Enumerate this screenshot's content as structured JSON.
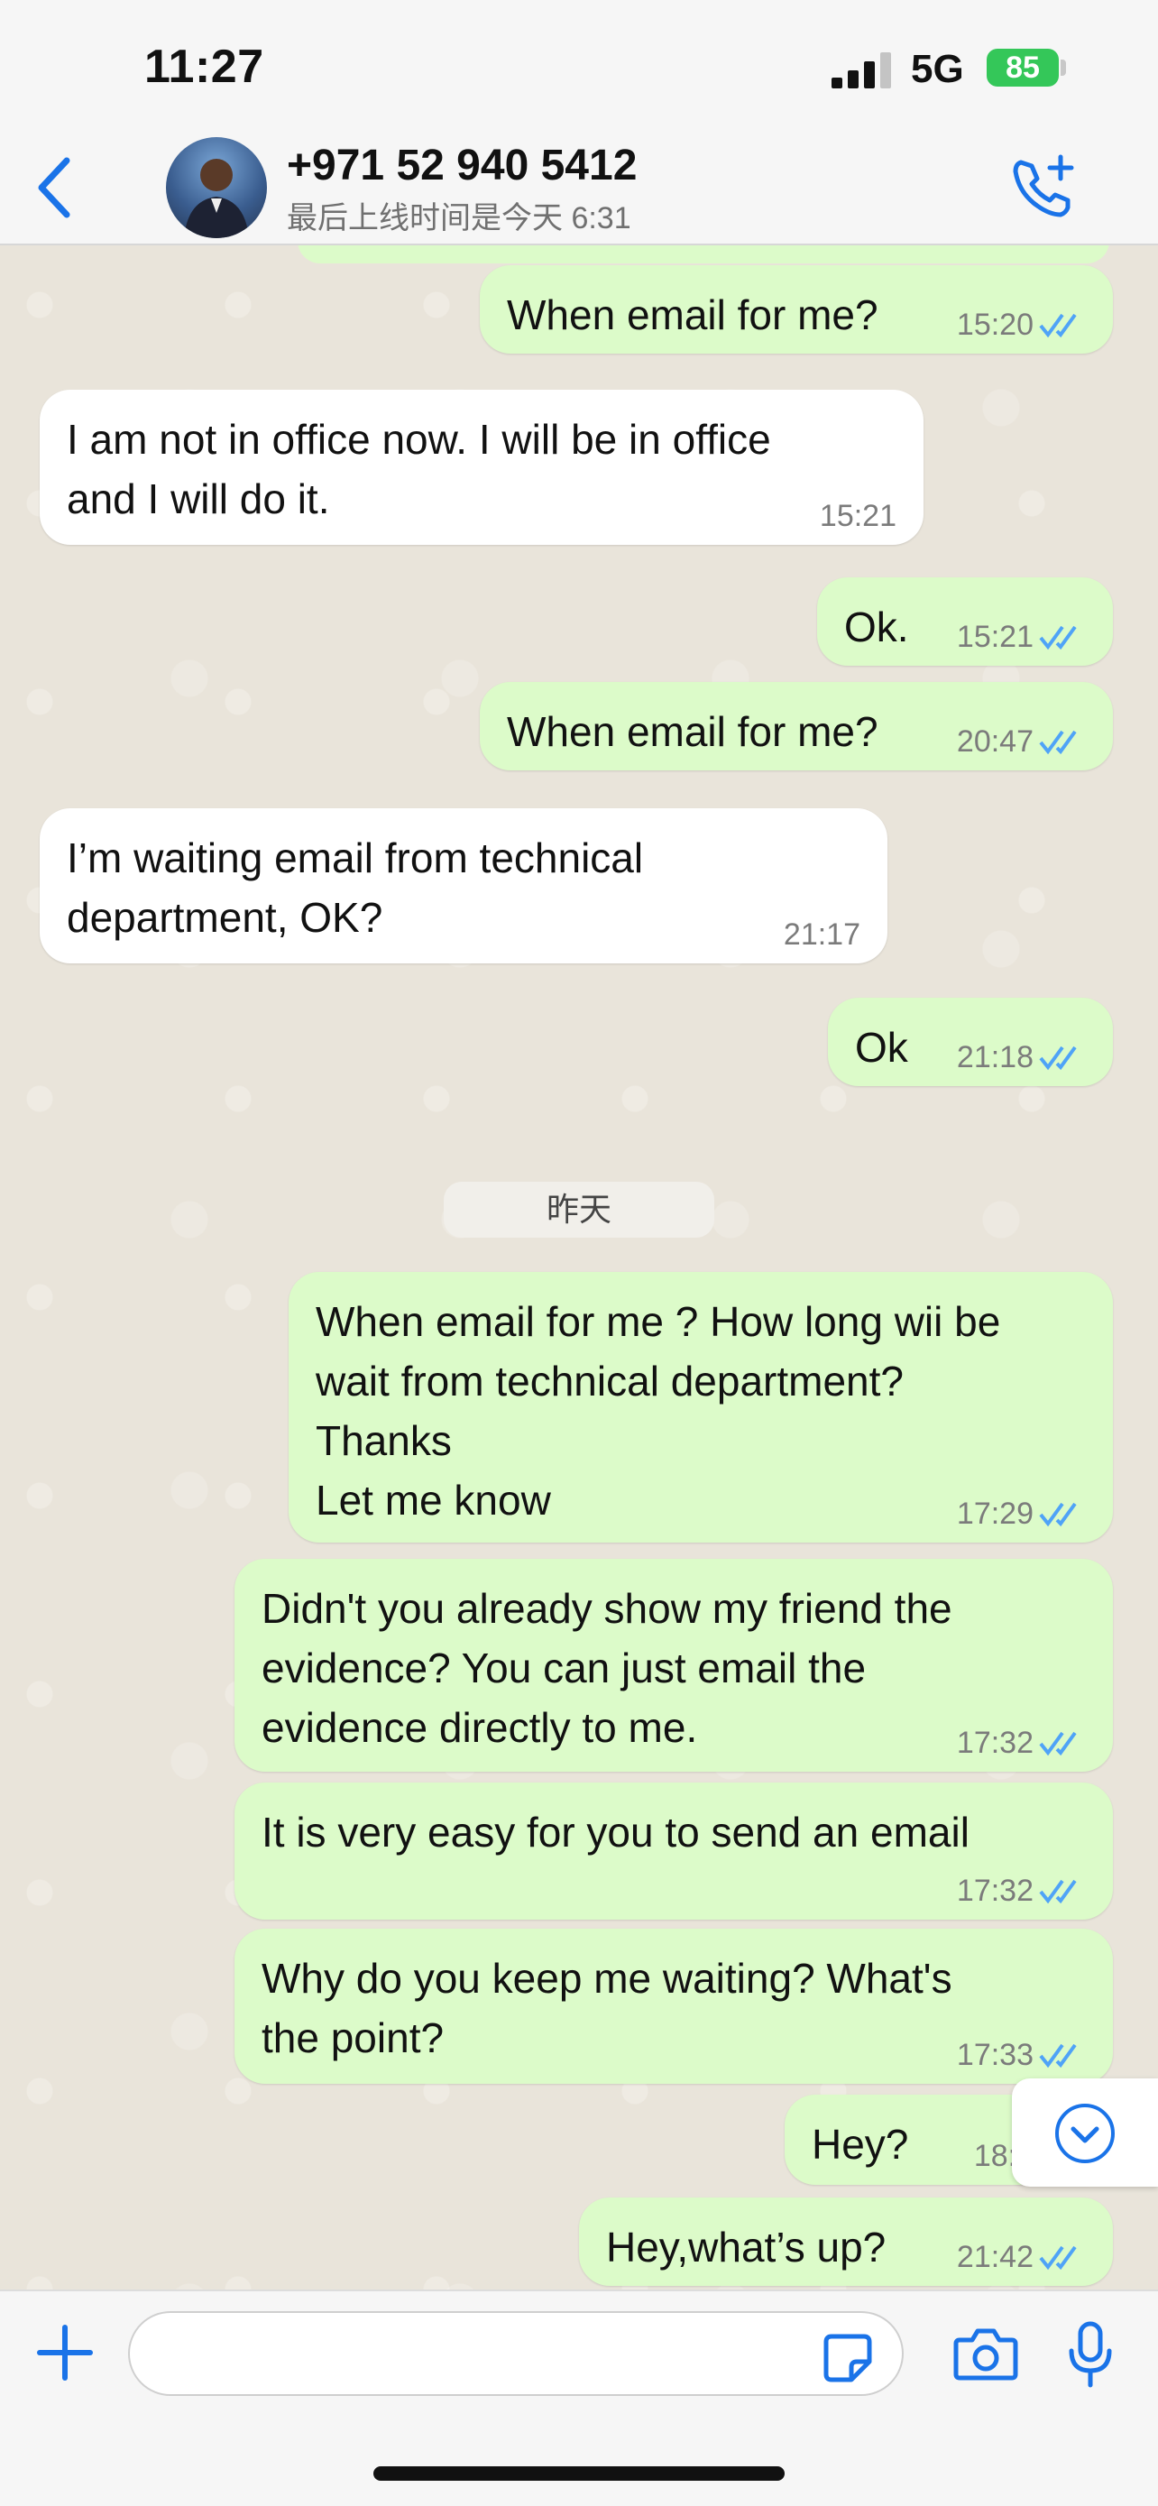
{
  "status_bar": {
    "time": "11:27",
    "network": "5G",
    "battery": "85"
  },
  "header": {
    "contact_name": "+971 52 940 5412",
    "last_seen": "最后上线时间是今天 6:31",
    "back_icon": "chevron-left-icon",
    "call_icon": "phone-plus-icon"
  },
  "messages": [
    {
      "dir": "out",
      "text": "When email for me?",
      "time": "15:20",
      "read": true
    },
    {
      "dir": "in",
      "text": "I am not in office now. I will be in office\nand I will do it.",
      "time": "15:21"
    },
    {
      "dir": "out",
      "text": "Ok.",
      "time": "15:21",
      "read": true
    },
    {
      "dir": "out",
      "text": "When email for me?",
      "time": "20:47",
      "read": true
    },
    {
      "dir": "in",
      "text": "I’m waiting email from technical\ndepartment, OK?",
      "time": "21:17"
    },
    {
      "dir": "out",
      "text": "Ok",
      "time": "21:18",
      "read": true
    },
    {
      "dir": "out",
      "text": "When email for me ? How long wii be\nwait from technical department?\nThanks\nLet me know",
      "time": "17:29",
      "read": true
    },
    {
      "dir": "out",
      "text": "Didn't you already show my friend the\nevidence? You can just email the\nevidence directly to me.",
      "time": "17:32",
      "read": true
    },
    {
      "dir": "out",
      "text": "It is very easy for you to send an email",
      "time": "17:32",
      "read": true
    },
    {
      "dir": "out",
      "text": "Why do you keep me waiting? What's\nthe point?",
      "time": "17:33",
      "read": true
    },
    {
      "dir": "out",
      "text": "Hey?",
      "time": "18:3",
      "read": true
    },
    {
      "dir": "out",
      "text": "Hey,what’s up?",
      "time": "21:42",
      "read": true
    }
  ],
  "date_divider": "昨天",
  "composer": {
    "placeholder": "",
    "icons": [
      "plus-icon",
      "sticker-icon",
      "camera-icon",
      "microphone-icon"
    ]
  },
  "colors": {
    "accent": "#1a73e8",
    "outgoing_bubble": "#dcfbc9",
    "incoming_bubble": "#ffffff",
    "read_ticks": "#4fa3f7",
    "battery": "#34c759"
  }
}
